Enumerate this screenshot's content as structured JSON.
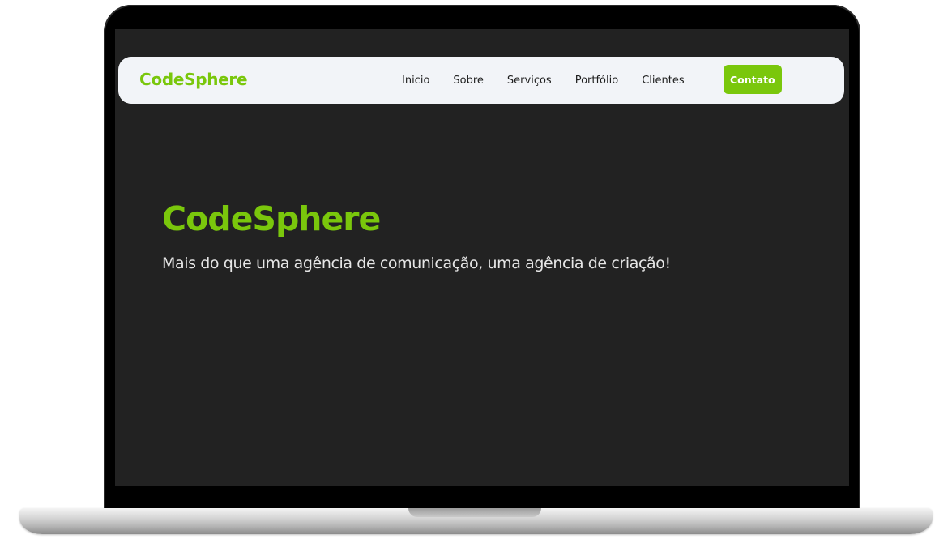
{
  "navbar": {
    "logo": "CodeSphere",
    "links": [
      "Inicio",
      "Sobre",
      "Serviços",
      "Portfólio",
      "Clientes"
    ],
    "cta_label": "Contato"
  },
  "hero": {
    "title": "CodeSphere",
    "subtitle": "Mais do que uma agência de comunicação, uma agência de criação!"
  },
  "colors": {
    "accent": "#7ac70c",
    "page_background": "#222222",
    "navbar_background": "#f2f4f8",
    "text_light": "#e6e6e6",
    "text_dark": "#1f1f1f"
  }
}
